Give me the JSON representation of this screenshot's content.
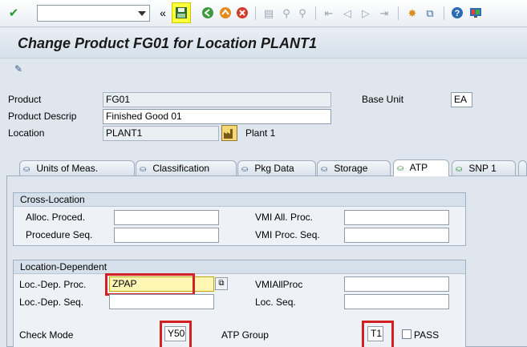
{
  "toolbar": {
    "command_field_value": "",
    "icons": [
      "check-icon",
      "double-chevron-icon",
      "save-icon",
      "back-icon",
      "exit-icon",
      "cancel-icon",
      "print-icon",
      "find-icon",
      "find-next-icon",
      "first-page-icon",
      "previous-page-icon",
      "next-page-icon",
      "last-page-icon",
      "create-session-icon",
      "shortcut-icon",
      "help-icon",
      "customize-layout-icon"
    ]
  },
  "title": "Change Product FG01 for Location PLANT1",
  "header": {
    "product_label": "Product",
    "product_value": "FG01",
    "product_descrip_label": "Product Descrip",
    "product_descrip_value": "Finished Good 01",
    "location_label": "Location",
    "location_value": "PLANT1",
    "location_text": "Plant 1",
    "base_unit_label": "Base Unit",
    "base_unit_value": "EA"
  },
  "tabs": [
    {
      "label": "Units of Meas.",
      "active": false
    },
    {
      "label": "Classification",
      "active": false
    },
    {
      "label": "Pkg Data",
      "active": false
    },
    {
      "label": "Storage",
      "active": false
    },
    {
      "label": "ATP",
      "active": true
    },
    {
      "label": "SNP 1",
      "active": false
    }
  ],
  "cross_location": {
    "title": "Cross-Location",
    "alloc_proced_label": "Alloc. Proced.",
    "alloc_proced_value": "",
    "procedure_seq_label": "Procedure Seq.",
    "procedure_seq_value": "",
    "vmi_all_proc_label": "VMI All. Proc.",
    "vmi_all_proc_value": "",
    "vmi_proc_seq_label": "VMI Proc. Seq.",
    "vmi_proc_seq_value": ""
  },
  "location_dependent": {
    "title": "Location-Dependent",
    "loc_dep_proc_label": "Loc.-Dep. Proc.",
    "loc_dep_proc_value": "ZPAP",
    "loc_dep_seq_label": "Loc.-Dep. Seq.",
    "loc_dep_seq_value": "",
    "vmi_all_proc_label": "VMIAllProc",
    "vmi_all_proc_value": "",
    "loc_seq_label": "Loc. Seq.",
    "loc_seq_value": "",
    "check_mode_label": "Check Mode",
    "check_mode_value": "Y50",
    "atp_group_label": "ATP Group",
    "atp_group_value": "T1",
    "pass_label": "PASS",
    "pass_checked": false
  },
  "colors": {
    "highlight_red": "#d32020",
    "save_highlight": "#ffff3a",
    "field_highlight": "#fff7b3"
  }
}
